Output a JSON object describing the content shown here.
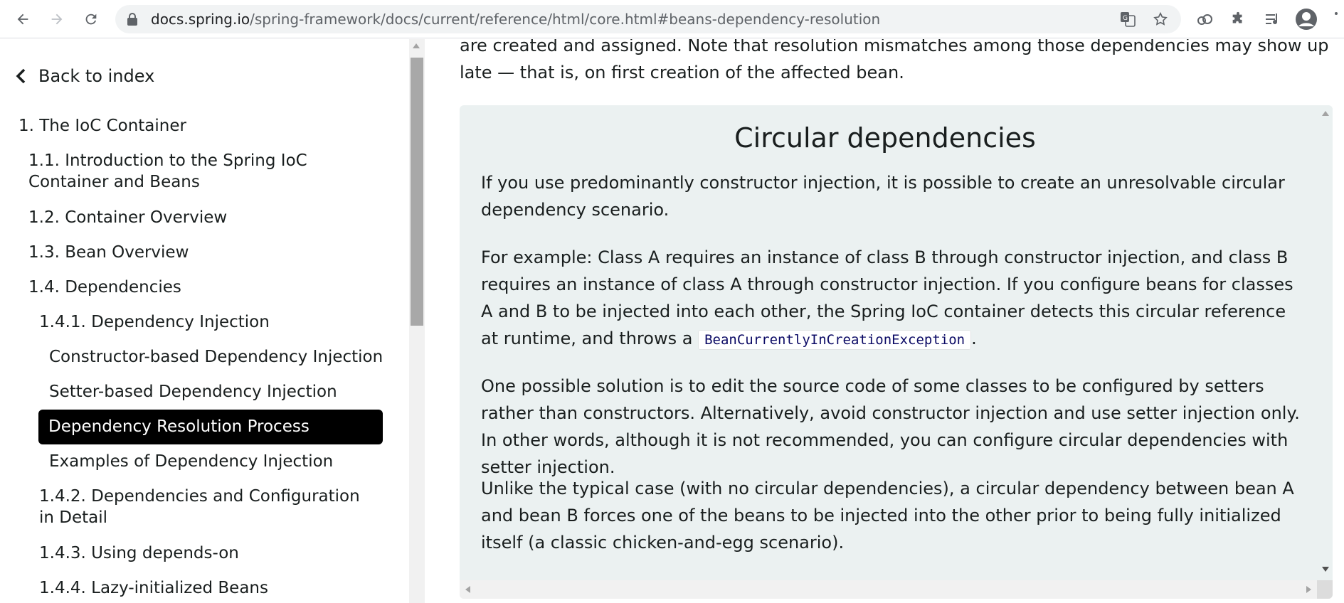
{
  "browser": {
    "url_host": "docs.spring.io",
    "url_path": "/spring-framework/docs/current/reference/html/core.html#beans-dependency-resolution"
  },
  "sidebar": {
    "back_label": "Back to index",
    "items": [
      "1. The IoC Container",
      "1.1. Introduction to the Spring IoC Container and Beans",
      "1.2. Container Overview",
      "1.3. Bean Overview",
      "1.4. Dependencies",
      "1.4.1. Dependency Injection",
      "Constructor-based Dependency Injection",
      "Setter-based Dependency Injection",
      "Dependency Resolution Process",
      "Examples of Dependency Injection",
      "1.4.2. Dependencies and Configuration in Detail",
      "1.4.3. Using depends-on",
      "1.4.4. Lazy-initialized Beans"
    ]
  },
  "content": {
    "intro": "are created and assigned. Note that resolution mismatches among those dependencies may show up late — that is, on first creation of the affected bean.",
    "box_title": "Circular dependencies",
    "p1": "If you use predominantly constructor injection, it is possible to create an unresolvable circular dependency scenario.",
    "p2_text": "For example: Class A requires an instance of class B through constructor injection, and class B requires an instance of class A through constructor injection. If you configure beans for classes A and B to be injected into each other, the Spring IoC container detects this circular reference at runtime, and throws a",
    "p2_code": "BeanCurrentlyInCreationException",
    "p2_end": ".",
    "p3": "One possible solution is to edit the source code of some classes to be configured by setters rather than constructors. Alternatively, avoid constructor injection and use setter injection only. In other words, although it is not recommended, you can configure circular dependencies with setter injection.",
    "p4": "Unlike the typical case (with no circular dependencies), a circular dependency between bean A and bean B forces one of the beans to be injected into the other prior to being fully initialized itself (a classic chicken-and-egg scenario)."
  }
}
